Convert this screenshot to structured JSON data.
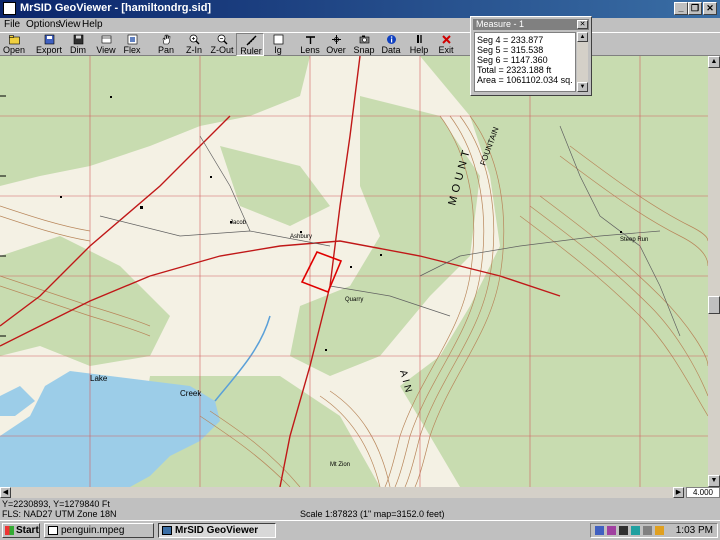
{
  "window": {
    "title": "MrSID GeoViewer - [hamiltondrg.sid]",
    "minimize_glyph": "_",
    "restore_glyph": "❐",
    "close_glyph": "✕"
  },
  "menu": [
    "File",
    "Options",
    "View",
    "Help"
  ],
  "toolbar": [
    {
      "label": "Open",
      "icon": "open-folder-icon"
    },
    {
      "label": "Export",
      "icon": "export-icon"
    },
    {
      "label": "Dim",
      "icon": "save-icon"
    },
    {
      "label": "View",
      "icon": "view-icon"
    },
    {
      "label": "Flex",
      "icon": "flex-icon"
    },
    {
      "label": "Pan",
      "icon": "pan-hand-icon"
    },
    {
      "label": "Z-In",
      "icon": "zoom-in-icon"
    },
    {
      "label": "Z-Out",
      "icon": "zoom-out-icon"
    },
    {
      "label": "Ruler",
      "icon": "ruler-icon",
      "active": true
    },
    {
      "label": "Ig",
      "icon": "image-icon"
    },
    {
      "label": "Lens",
      "icon": "lens-icon"
    },
    {
      "label": "Over",
      "icon": "overview-icon"
    },
    {
      "label": "Snap",
      "icon": "snap-icon"
    },
    {
      "label": "Data",
      "icon": "info-icon"
    },
    {
      "label": "Help",
      "icon": "help-icon"
    },
    {
      "label": "Exit",
      "icon": "exit-icon"
    }
  ],
  "measure": {
    "title": "Measure - 1",
    "lines": [
      "Seg 4 = 233.877",
      "Seg 5 = 315.538",
      "Seg 6 = 1147.360",
      "Total = 2323.188 ft",
      "Area = 1061102.034 sq."
    ]
  },
  "map": {
    "labels": [
      "MOUNT",
      "AIN",
      "FOUNTAIN",
      "Creek",
      "Lake",
      "Steep Run",
      "Mt Zion",
      "Ashbury",
      "Jacob",
      "Quarry"
    ]
  },
  "status": {
    "coords_line1": "Y=2230893, Y=1279840 Ft",
    "coords_line2": "FLS: NAD27 UTM Zone 18N",
    "scale": "Scale 1:87823 (1\" map=3152.0 feet)",
    "zoom": "4.000"
  },
  "taskbar": {
    "start": "Start",
    "tasks": [
      "penguin.mpeg",
      "MrSID GeoViewer"
    ],
    "clock": "1:03 PM"
  },
  "colors": {
    "title_bar": "#0a246a",
    "map_paper": "#f4f1e4",
    "forest": "#c8dcb0",
    "contour": "#b8865a",
    "water": "#9ccde8",
    "selection": "#e00000"
  }
}
